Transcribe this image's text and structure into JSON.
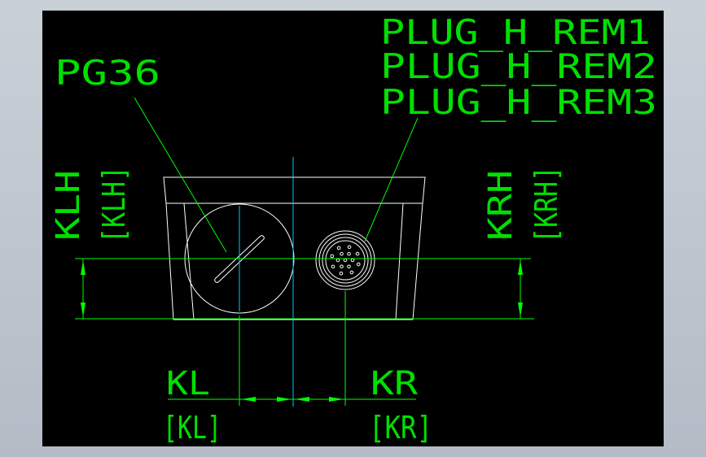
{
  "labels": {
    "pg": "PG36",
    "plug1": "PLUG_H_REM1",
    "plug2": "PLUG_H_REM2",
    "plug3": "PLUG_H_REM3",
    "klh": "KLH",
    "klh_b": "[KLH]",
    "krh": "KRH",
    "krh_b": "[KRH]",
    "kl": "KL",
    "kl_b": "[KL]",
    "kr": "KR",
    "kr_b": "[KR]"
  },
  "colors": {
    "background": "#000000",
    "frame": "#c0c8d0",
    "dimension": "#00ff00",
    "outline": "#ffffff",
    "centerline": "#00c8ff"
  }
}
